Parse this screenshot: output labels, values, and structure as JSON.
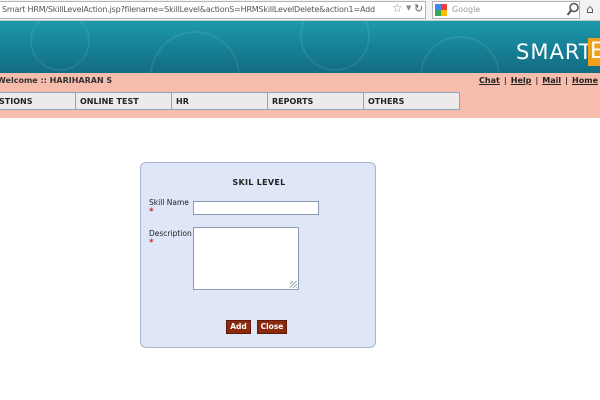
{
  "browser": {
    "url": "Smart HRM/SkillLevelAction.jsp?filename=SkillLevel&actionS=HRMSkillLevelDelete&action1=Add",
    "search_placeholder": "Google",
    "icons": [
      "star-icon",
      "dropdown-icon",
      "reload-icon",
      "google-icon",
      "magnifier-icon",
      "home-icon"
    ]
  },
  "banner": {
    "logo_text": "SMART",
    "logo_letter": "E",
    "bg_color": "#167f95",
    "accent_color": "#f0a018"
  },
  "header": {
    "welcome": "Welcome :: HARIHARAN S",
    "links": [
      "Chat",
      "Help",
      "Mail",
      "Home"
    ],
    "separator": "|"
  },
  "menu": {
    "items": [
      "STIONS",
      "ONLINE TEST",
      "HR",
      "REPORTS",
      "OTHERS"
    ]
  },
  "form": {
    "title": "SKIL LEVEL",
    "skill_name_label": "Skill Name",
    "skill_name_value": "",
    "description_label": "Description",
    "description_value": "",
    "required_mark": "*",
    "add_label": "Add",
    "close_label": "Close",
    "card_color": "#dfe6f8",
    "button_color": "#8b2a0c"
  }
}
